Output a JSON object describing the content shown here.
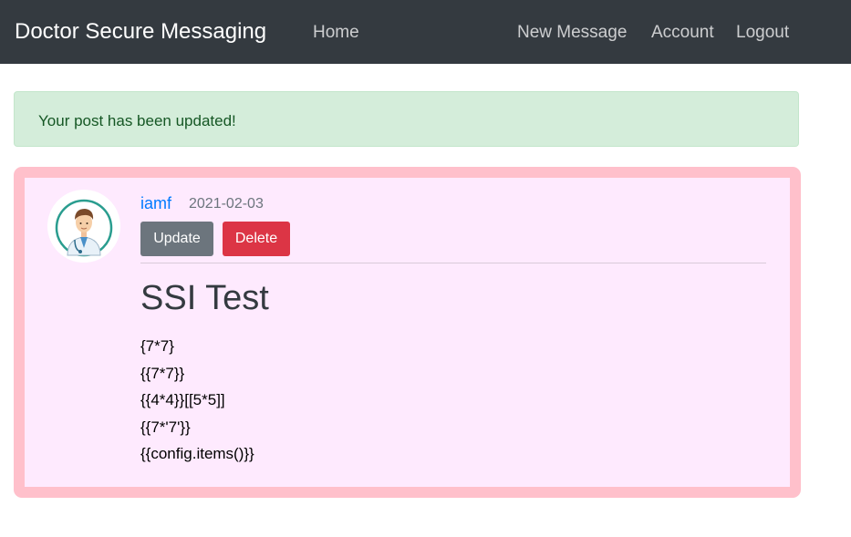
{
  "navbar": {
    "brand": "Doctor Secure Messaging",
    "links": [
      {
        "label": "Home"
      },
      {
        "label": "New Message"
      },
      {
        "label": "Account"
      },
      {
        "label": "Logout"
      }
    ]
  },
  "alert": {
    "message": "Your post has been updated!"
  },
  "post": {
    "author": "iamf",
    "date": "2021-02-03",
    "buttons": {
      "update": "Update",
      "delete": "Delete"
    },
    "title": "SSI Test",
    "content_lines": [
      "{7*7}",
      "{{7*7}}",
      "{{4*4}}[[5*5]]",
      "{{7*'7'}}",
      "{{config.items()}}"
    ],
    "avatar_icon": "doctor-avatar-icon"
  },
  "colors": {
    "navbar_bg": "#343a40",
    "alert_bg": "#d4edda",
    "alert_text": "#155724",
    "post_border": "#ffc0cb",
    "post_bg": "#feeafe",
    "link": "#007bff",
    "update_button": "#6c757d",
    "delete_button": "#dc3545"
  }
}
